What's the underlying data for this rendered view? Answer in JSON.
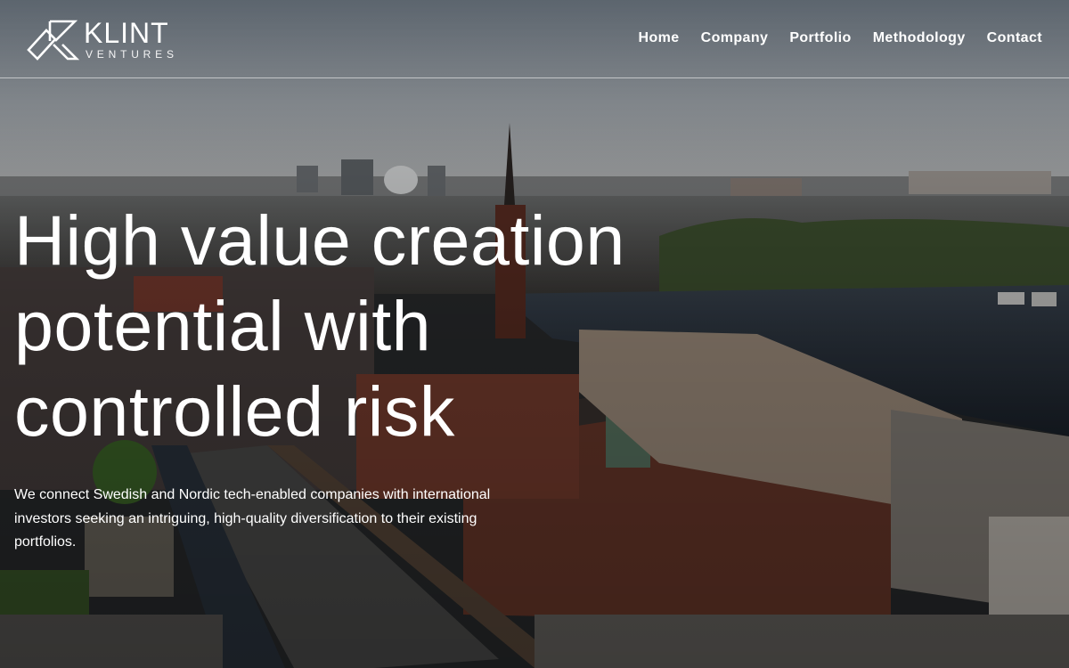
{
  "brand": {
    "name": "KLINT",
    "tagline": "VENTURES"
  },
  "nav": {
    "items": [
      {
        "label": "Home"
      },
      {
        "label": "Company"
      },
      {
        "label": "Portfolio"
      },
      {
        "label": "Methodology"
      },
      {
        "label": "Contact"
      }
    ]
  },
  "hero": {
    "headline_lines": [
      "High value creation",
      "potential with",
      "controlled risk"
    ],
    "intro": "We connect Swedish and Nordic tech-enabled companies with international investors seeking an intriguing, high-quality diversification to their existing portfolios.",
    "background": "aerial-city-photo"
  },
  "colors": {
    "sky_top": "#66707a",
    "sky_bottom": "#b3b7bb",
    "water": "#232c37",
    "brick": "#6e3a2c",
    "text": "#ffffff"
  }
}
